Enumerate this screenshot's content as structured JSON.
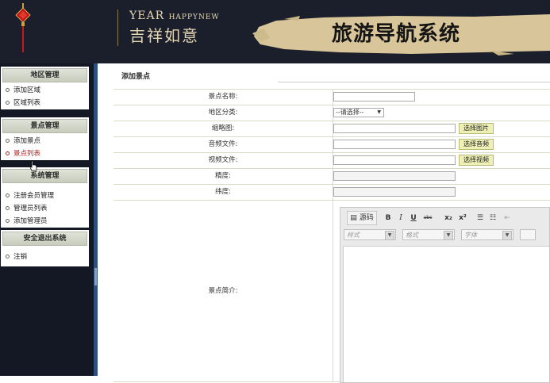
{
  "header": {
    "brand_en": "YEAR",
    "brand_en_small": "HAPPYNEW",
    "brand_cn": "吉祥如意",
    "system_title": "旅游导航系统"
  },
  "sidebar": {
    "groups": [
      {
        "title": "地区管理",
        "items": [
          "添加区域",
          "区域列表"
        ]
      },
      {
        "title": "景点管理",
        "items": [
          "添加景点",
          "景点列表"
        ]
      },
      {
        "title": "系统管理",
        "items": [
          "注册会员管理",
          "管理员列表",
          "添加管理员"
        ]
      },
      {
        "title": "安全退出系统",
        "items": [
          "注销"
        ]
      }
    ]
  },
  "main": {
    "breadcrumb": "添加景点",
    "form": {
      "name_label": "景点名称:",
      "region_label": "地区分类:",
      "region_select": "--请选择--",
      "thumb_label": "缩略图:",
      "thumb_button": "选择图片",
      "audio_label": "音频文件:",
      "audio_button": "选择音频",
      "video_label": "视频文件:",
      "video_button": "选择视频",
      "lng_label": "精度:",
      "lat_label": "纬度:",
      "desc_label": "景点简介:"
    },
    "editor": {
      "source_label": "源码",
      "bold": "B",
      "italic": "I",
      "underline": "U",
      "strike": "abc",
      "subscript": "x₂",
      "superscript": "x²",
      "style_placeholder": "样式",
      "format_placeholder": "格式",
      "font_placeholder": "字体"
    }
  },
  "colors": {
    "header_bg": "#1b1f2b",
    "sidebar_bg": "#131824",
    "active_link": "#b81c1c",
    "button_bg": "#eef0b8"
  }
}
